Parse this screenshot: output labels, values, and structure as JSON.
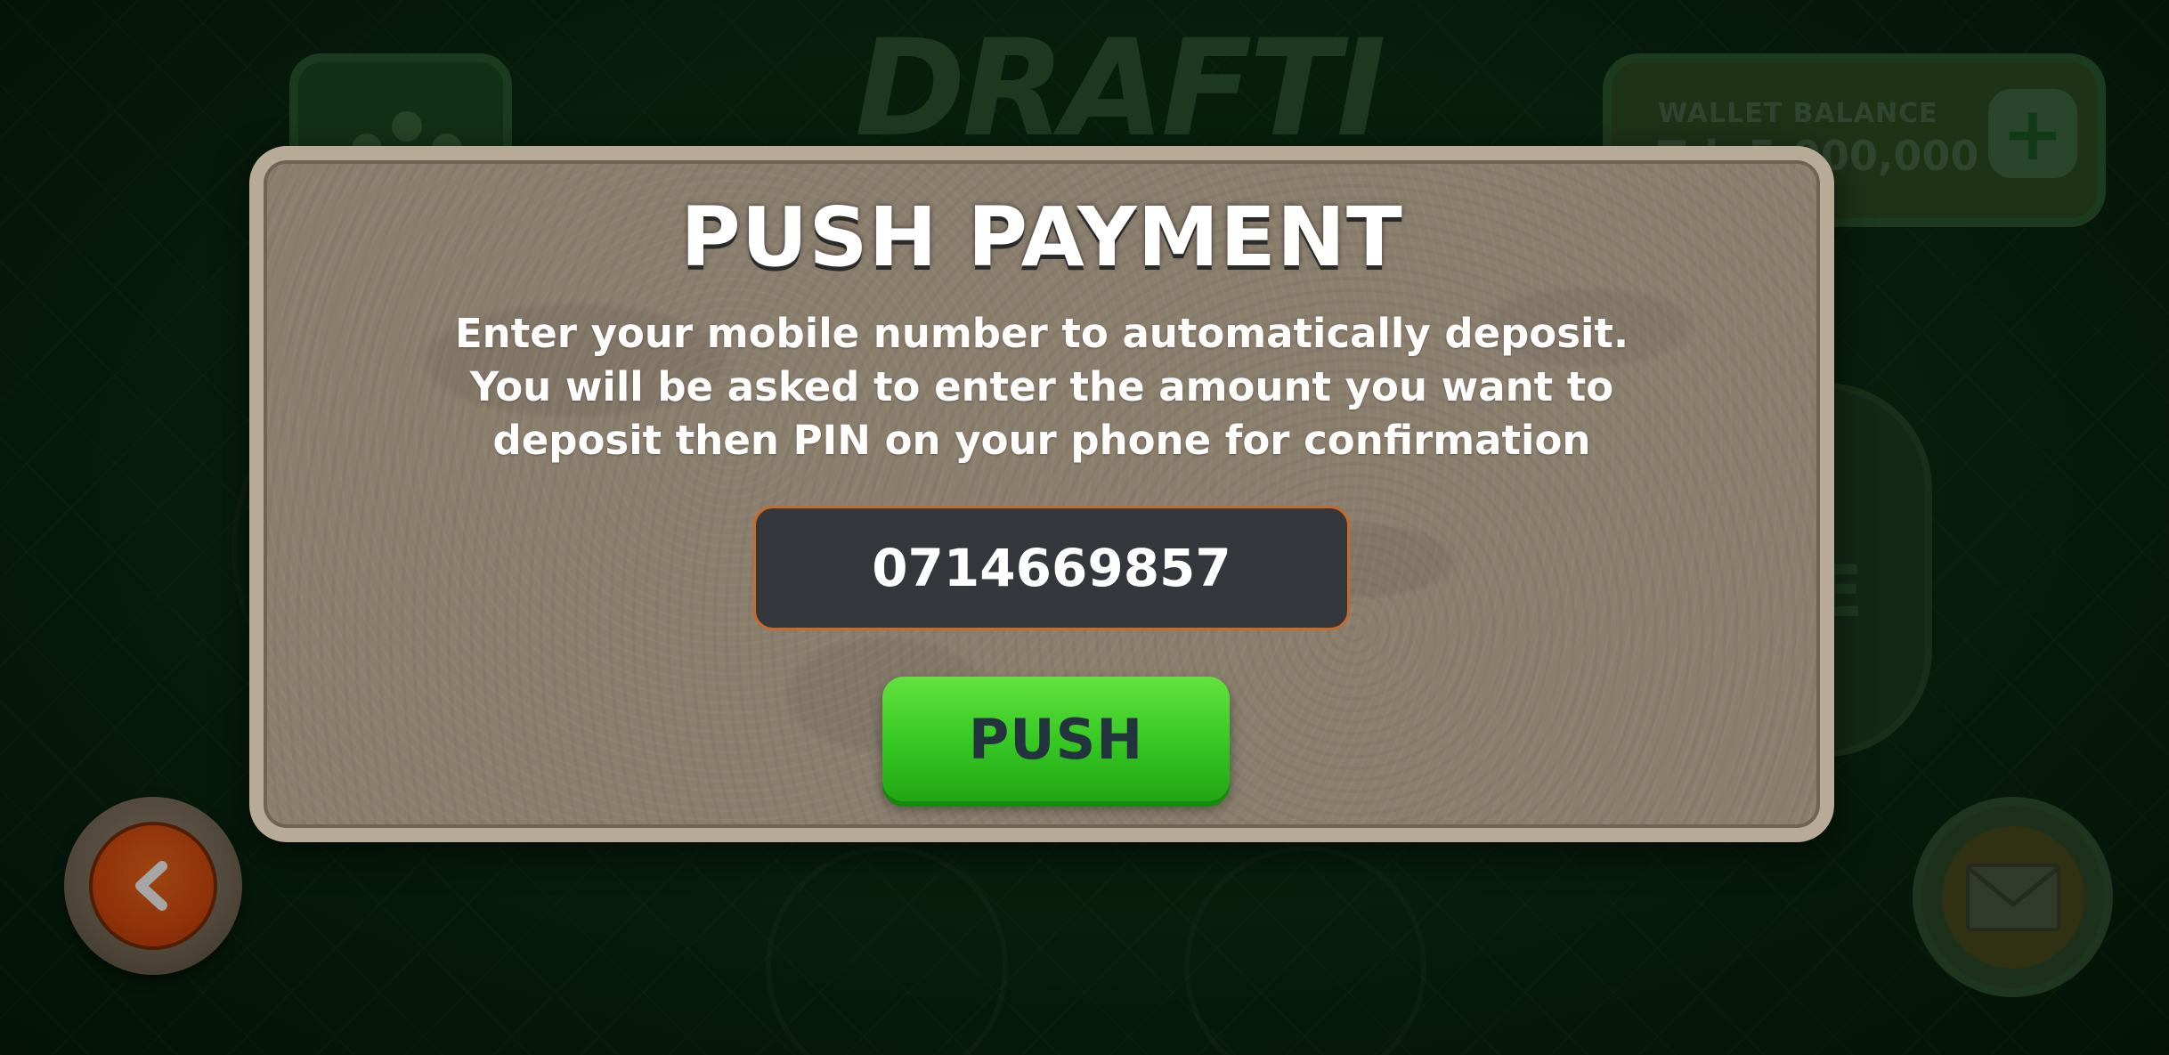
{
  "background": {
    "logo_text": "DRAFTI",
    "wallet": {
      "label": "WALLET BALANCE",
      "amount": "Tsh 5,000,000"
    },
    "side_badge_text": "E"
  },
  "modal": {
    "title": "PUSH PAYMENT",
    "description": "Enter your mobile number to automatically deposit. You will be asked to enter the amount you want to deposit then PIN on your phone for confirmation",
    "phone_number": "0714669857",
    "push_label": "PUSH"
  },
  "colors": {
    "modal_bg": "#8a7e6d",
    "modal_border": "#b7ab97",
    "input_bg": "#34383c",
    "input_border": "#c86a2a",
    "push_button": "#34c622",
    "back_button": "#de4e10",
    "background_green": "#0b2d14"
  },
  "icons": {
    "back": "chevron-left-icon",
    "mail": "mail-icon",
    "add": "plus-icon",
    "friends": "friends-icon"
  }
}
